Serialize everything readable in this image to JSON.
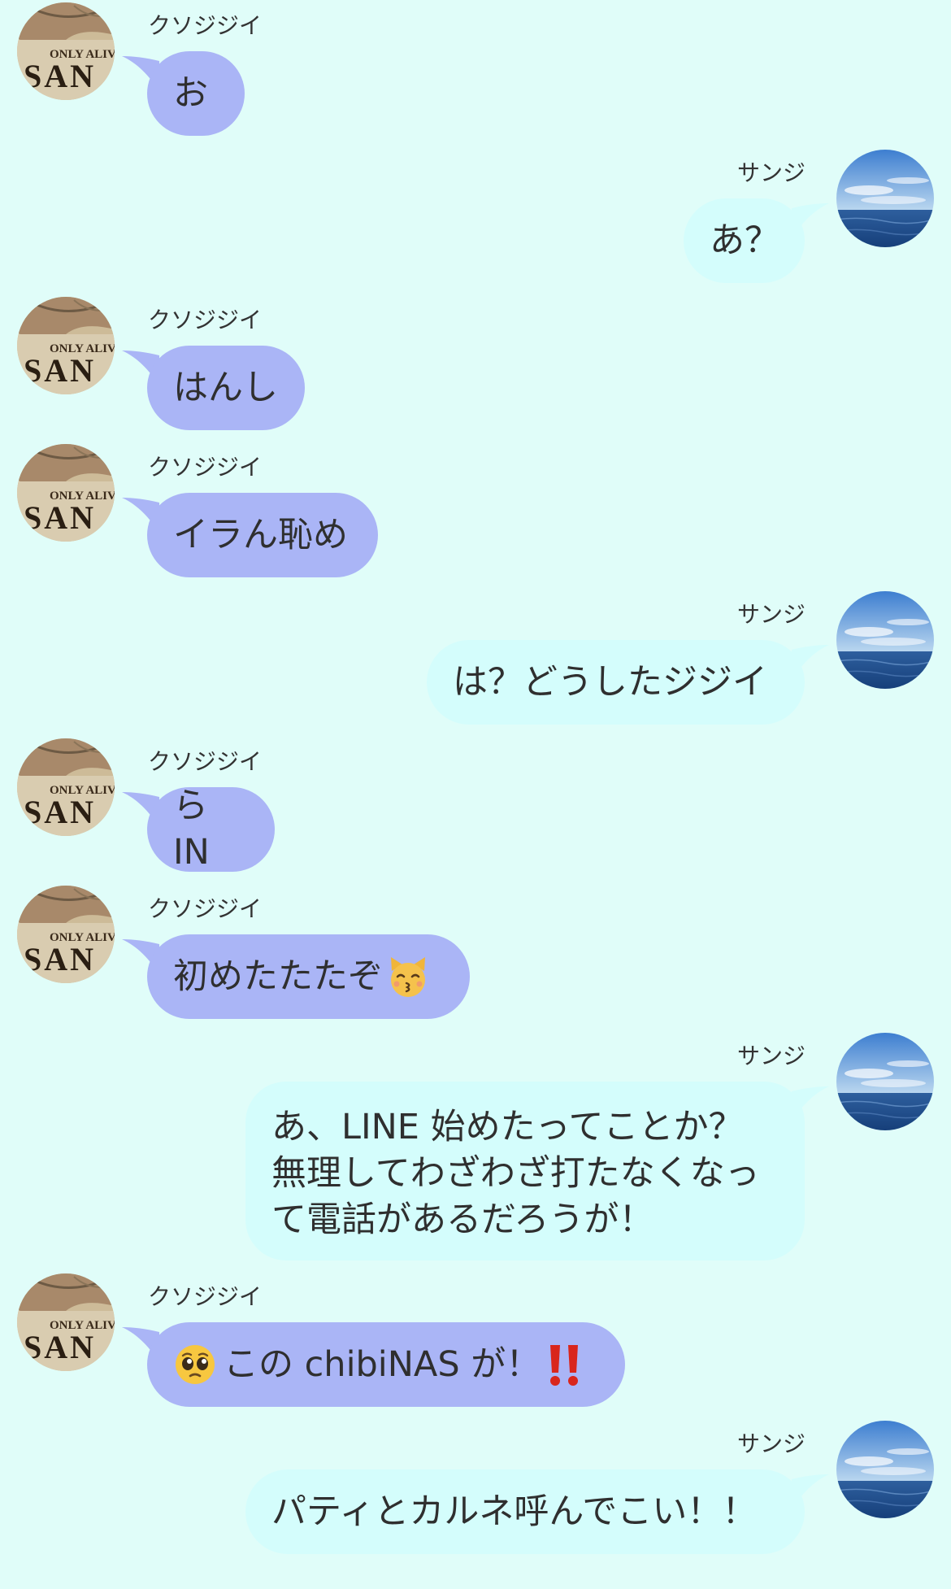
{
  "participants": {
    "left": {
      "name": "クソジジイ",
      "avatar_text_top": "ONLY ALIV",
      "avatar_text_bottom": "SAN"
    },
    "right": {
      "name": "サンジ"
    }
  },
  "colors": {
    "background": "#e0fdf9",
    "left_bubble": "#aab5f6",
    "right_bubble": "#d4fdfc",
    "text": "#2f2f2f"
  },
  "messages": [
    {
      "side": "left",
      "sender": "クソジジイ",
      "text": "お"
    },
    {
      "side": "right",
      "sender": "サンジ",
      "text": "あ？"
    },
    {
      "side": "left",
      "sender": "クソジジイ",
      "text": "はんし"
    },
    {
      "side": "left",
      "sender": "クソジジイ",
      "text": "イラん恥め"
    },
    {
      "side": "right",
      "sender": "サンジ",
      "text": "は？どうしたジジイ"
    },
    {
      "side": "left",
      "sender": "クソジジイ",
      "text": "ら IN"
    },
    {
      "side": "left",
      "sender": "クソジジイ",
      "text": "初めたたたぞ",
      "emoji_after": "kissing-cat-emoji"
    },
    {
      "side": "right",
      "sender": "サンジ",
      "text": "あ、LINE 始めたってことか？\n無理してわざわざ打たなくなっ\nて電話があるだろうが！"
    },
    {
      "side": "left",
      "sender": "クソジジイ",
      "text": "この chibiNAS が！",
      "emoji_before": "pleading-face-emoji",
      "emoji_after": "double-exclamation-emoji"
    },
    {
      "side": "right",
      "sender": "サンジ",
      "text": "パティとカルネ呼んでこい！！"
    }
  ]
}
